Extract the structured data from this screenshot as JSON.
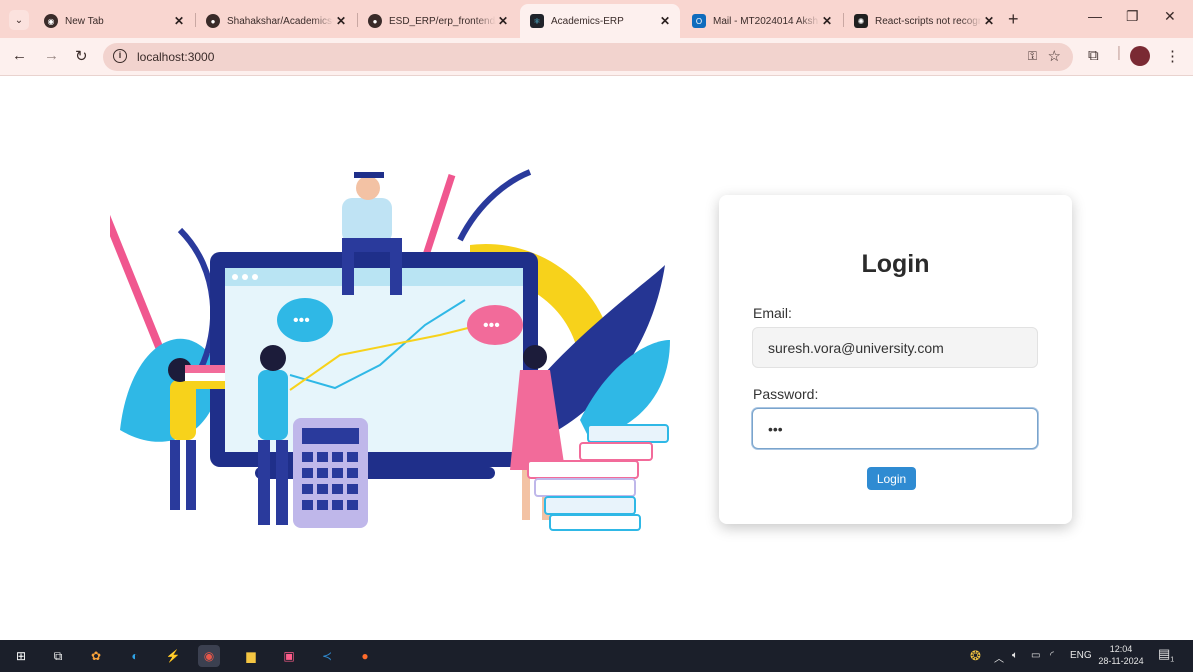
{
  "browser": {
    "tabs": [
      {
        "title": "New Tab",
        "favicon": "chrome-icon",
        "active": false
      },
      {
        "title": "Shahakshar/Academics-",
        "favicon": "github-icon",
        "active": false
      },
      {
        "title": "ESD_ERP/erp_frontend/",
        "favicon": "github-icon",
        "active": false
      },
      {
        "title": "Academics-ERP",
        "favicon": "react-icon",
        "active": true
      },
      {
        "title": "Mail - MT2024014 Aksh",
        "favicon": "outlook-icon",
        "active": false
      },
      {
        "title": "React-scripts not recogn",
        "favicon": "chatgpt-icon",
        "active": false
      }
    ],
    "url": "localhost:3000",
    "accent": "#f9d6d0"
  },
  "login": {
    "title": "Login",
    "email_label": "Email:",
    "email_value": "suresh.vora@university.com",
    "password_label": "Password:",
    "password_value": "•••",
    "button_label": "Login",
    "button_color": "#2f8bd2"
  },
  "taskbar": {
    "language": "ENG",
    "time": "12:04",
    "date": "28-11-2024",
    "notification_count": "1"
  }
}
